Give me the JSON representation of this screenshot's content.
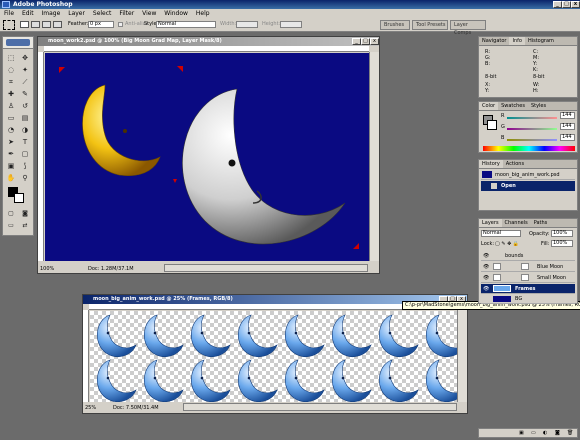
{
  "app": {
    "title": "Adobe Photoshop"
  },
  "menu": [
    "File",
    "Edit",
    "Image",
    "Layer",
    "Select",
    "Filter",
    "View",
    "Window",
    "Help"
  ],
  "options": {
    "feather_label": "Feather:",
    "feather_value": "0 px",
    "antialias_label": "Anti-alias",
    "style_label": "Style:",
    "style_value": "Normal",
    "width_label": "Width:",
    "height_label": "Height:"
  },
  "palette_well": [
    "Brushes",
    "Tool Presets",
    "Layer Comps"
  ],
  "doc1": {
    "title": "moon_work2.psd @ 100% (Big Moon Grad Map, Layer Mask/8)",
    "zoom": "100%",
    "doc_info": "Doc: 1.28M/37.1M"
  },
  "doc2": {
    "title": "moon_big_anim_work.psd @ 25% (Frames, RGB/8)",
    "zoom": "25%",
    "doc_info": "Doc: 7.50M/31.4M",
    "tooltip": "C:\\p-pr\\MadStone\\gems\\moon_big_anim_work.psd @ 25% (Frames, RGB/8)"
  },
  "navigator": {
    "tabs": [
      "Navigator",
      "Info",
      "Histogram"
    ],
    "rows": [
      {
        "left": "R:",
        "right": "C:"
      },
      {
        "left": "G:",
        "right": "M:"
      },
      {
        "left": "B:",
        "right": "Y:"
      },
      {
        "left": "",
        "right": "K:"
      },
      {
        "left": "8-bit",
        "right": "8-bit"
      },
      {
        "left": "X:",
        "right": "W:"
      },
      {
        "left": "Y:",
        "right": "H:"
      }
    ]
  },
  "color": {
    "tabs": [
      "Color",
      "Swatches",
      "Styles"
    ],
    "channels": [
      {
        "name": "R",
        "value": "144"
      },
      {
        "name": "G",
        "value": "144"
      },
      {
        "name": "B",
        "value": "144"
      }
    ]
  },
  "history": {
    "tabs": [
      "History",
      "Actions"
    ],
    "snapshot": "moon_big_anim_work.psd",
    "step": "Open"
  },
  "layers": {
    "tabs": [
      "Layers",
      "Channels",
      "Paths"
    ],
    "blend": "Normal",
    "opacity_label": "Opacity:",
    "opacity": "100%",
    "lock_label": "Lock:",
    "fill_label": "Fill:",
    "fill": "100%",
    "items": [
      "bounds",
      "Blue Moon",
      "Small Moon",
      "Frames",
      "BG"
    ]
  },
  "colors": {
    "doc_bg": "#0a0a82",
    "accent": "#0a246a",
    "gray_bg": "#6b6b6b"
  }
}
